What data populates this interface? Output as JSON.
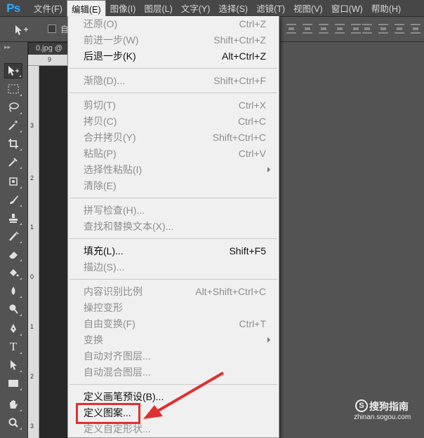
{
  "app": {
    "logo": "Ps"
  },
  "menubar": {
    "items": [
      {
        "label": "文件(F)"
      },
      {
        "label": "编辑(E)"
      },
      {
        "label": "图像(I)"
      },
      {
        "label": "图层(L)"
      },
      {
        "label": "文字(Y)"
      },
      {
        "label": "选择(S)"
      },
      {
        "label": "滤镜(T)"
      },
      {
        "label": "视图(V)"
      },
      {
        "label": "窗口(W)"
      },
      {
        "label": "帮助(H)"
      }
    ]
  },
  "options_bar": {
    "auto_select_label": "自"
  },
  "document": {
    "tab_label": "0.jpg @"
  },
  "rulers": {
    "top_mark": "9",
    "left_marks": [
      "3",
      "2",
      "1",
      "0",
      "1",
      "2",
      "3"
    ]
  },
  "edit_menu": {
    "items": [
      {
        "label": "还原(O)",
        "shortcut": "Ctrl+Z",
        "enabled": false
      },
      {
        "label": "前进一步(W)",
        "shortcut": "Shift+Ctrl+Z",
        "enabled": false
      },
      {
        "label": "后退一步(K)",
        "shortcut": "Alt+Ctrl+Z",
        "enabled": true
      },
      {
        "label": "渐隐(D)...",
        "shortcut": "Shift+Ctrl+F",
        "enabled": false
      },
      {
        "label": "剪切(T)",
        "shortcut": "Ctrl+X",
        "enabled": false
      },
      {
        "label": "拷贝(C)",
        "shortcut": "Ctrl+C",
        "enabled": false
      },
      {
        "label": "合并拷贝(Y)",
        "shortcut": "Shift+Ctrl+C",
        "enabled": false
      },
      {
        "label": "粘贴(P)",
        "shortcut": "Ctrl+V",
        "enabled": false
      },
      {
        "label": "选择性粘贴(I)",
        "shortcut": "",
        "enabled": false,
        "submenu": true
      },
      {
        "label": "清除(E)",
        "shortcut": "",
        "enabled": false
      },
      {
        "label": "拼写检查(H)...",
        "shortcut": "",
        "enabled": false
      },
      {
        "label": "查找和替换文本(X)...",
        "shortcut": "",
        "enabled": false
      },
      {
        "label": "填充(L)...",
        "shortcut": "Shift+F5",
        "enabled": true
      },
      {
        "label": "描边(S)...",
        "shortcut": "",
        "enabled": false
      },
      {
        "label": "内容识别比例",
        "shortcut": "Alt+Shift+Ctrl+C",
        "enabled": false
      },
      {
        "label": "操控变形",
        "shortcut": "",
        "enabled": false
      },
      {
        "label": "自由变换(F)",
        "shortcut": "Ctrl+T",
        "enabled": false
      },
      {
        "label": "变换",
        "shortcut": "",
        "enabled": false,
        "submenu": true
      },
      {
        "label": "自动对齐图层...",
        "shortcut": "",
        "enabled": false
      },
      {
        "label": "自动混合图层...",
        "shortcut": "",
        "enabled": false
      },
      {
        "label": "定义画笔预设(B)...",
        "shortcut": "",
        "enabled": true
      },
      {
        "label": "定义图案...",
        "shortcut": "",
        "enabled": true
      },
      {
        "label": "定义自定形状...",
        "shortcut": "",
        "enabled": false
      }
    ]
  },
  "watermark": {
    "title": "搜狗指南",
    "subtitle": "zhinan.sogou.com",
    "logo": "S"
  },
  "colors": {
    "highlight": "#e03030",
    "ps_blue": "#31a8ff"
  }
}
